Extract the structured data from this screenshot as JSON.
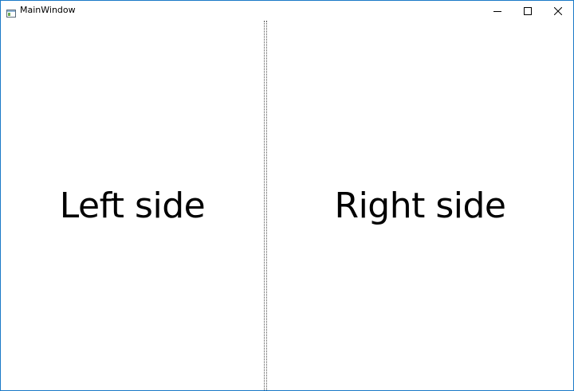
{
  "window": {
    "title": "MainWindow",
    "border_color": "#1a79c7",
    "icons": {
      "app": "window-app-icon",
      "minimize": "minimize-icon",
      "maximize": "maximize-icon",
      "close": "close-icon"
    }
  },
  "panes": {
    "left_text": "Left side",
    "right_text": "Right side"
  }
}
